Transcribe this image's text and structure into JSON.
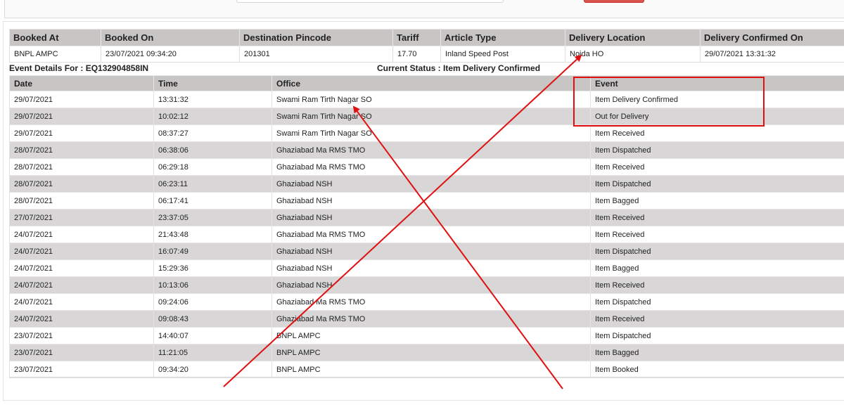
{
  "booking": {
    "headers": [
      "Booked At",
      "Booked On",
      "Destination Pincode",
      "Tariff",
      "Article Type",
      "Delivery Location",
      "Delivery Confirmed On"
    ],
    "row": [
      "BNPL AMPC",
      "23/07/2021 09:34:20",
      "201301",
      "17.70",
      "Inland Speed Post",
      "Noida HO",
      "29/07/2021 13:31:32"
    ]
  },
  "event_details_label": "Event Details For : EQ132904858IN",
  "current_status_label": "Current Status : Item Delivery Confirmed",
  "events": {
    "headers": [
      "Date",
      "Time",
      "Office",
      "Event"
    ],
    "rows": [
      [
        "29/07/2021",
        "13:31:32",
        "Swami Ram Tirth Nagar SO",
        "Item Delivery Confirmed"
      ],
      [
        "29/07/2021",
        "10:02:12",
        "Swami Ram Tirth Nagar SO",
        "Out for Delivery"
      ],
      [
        "29/07/2021",
        "08:37:27",
        "Swami Ram Tirth Nagar SO",
        "Item Received"
      ],
      [
        "28/07/2021",
        "06:38:06",
        "Ghaziabad Ma RMS TMO",
        "Item Dispatched"
      ],
      [
        "28/07/2021",
        "06:29:18",
        "Ghaziabad Ma RMS TMO",
        "Item Received"
      ],
      [
        "28/07/2021",
        "06:23:11",
        "Ghaziabad NSH",
        "Item Dispatched"
      ],
      [
        "28/07/2021",
        "06:17:41",
        "Ghaziabad NSH",
        "Item Bagged"
      ],
      [
        "27/07/2021",
        "23:37:05",
        "Ghaziabad NSH",
        "Item Received"
      ],
      [
        "24/07/2021",
        "21:43:48",
        "Ghaziabad Ma RMS TMO",
        "Item Received"
      ],
      [
        "24/07/2021",
        "16:07:49",
        "Ghaziabad NSH",
        "Item Dispatched"
      ],
      [
        "24/07/2021",
        "15:29:36",
        "Ghaziabad NSH",
        "Item Bagged"
      ],
      [
        "24/07/2021",
        "10:13:06",
        "Ghaziabad NSH",
        "Item Received"
      ],
      [
        "24/07/2021",
        "09:24:06",
        "Ghaziabad Ma RMS TMO",
        "Item Dispatched"
      ],
      [
        "24/07/2021",
        "09:08:43",
        "Ghaziabad Ma RMS TMO",
        "Item Received"
      ],
      [
        "23/07/2021",
        "14:40:07",
        "BNPL AMPC",
        "Item Dispatched"
      ],
      [
        "23/07/2021",
        "11:21:05",
        "BNPL AMPC",
        "Item Bagged"
      ],
      [
        "23/07/2021",
        "09:34:20",
        "BNPL AMPC",
        "Item Booked"
      ]
    ]
  },
  "annotation_color": "#e01010"
}
